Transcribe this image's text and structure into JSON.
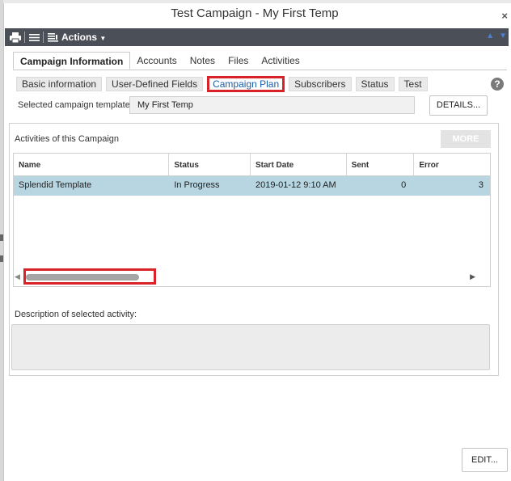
{
  "window": {
    "title": "Test Campaign - My First Temp",
    "close_symbol": "×"
  },
  "toolbar": {
    "print_icon": "print-icon",
    "list_icon": "list-icon",
    "actions_label": "Actions",
    "up_icon": "arrow-up-icon",
    "down_icon": "arrow-down-icon"
  },
  "tabs": [
    {
      "label": "Campaign Information",
      "active": true
    },
    {
      "label": "Accounts"
    },
    {
      "label": "Notes"
    },
    {
      "label": "Files"
    },
    {
      "label": "Activities"
    }
  ],
  "subtabs": [
    {
      "label": "Basic information"
    },
    {
      "label": "User-Defined Fields"
    },
    {
      "label": "Campaign Plan",
      "selected": true
    },
    {
      "label": "Subscribers"
    },
    {
      "label": "Status"
    },
    {
      "label": "Test"
    }
  ],
  "help_symbol": "?",
  "template": {
    "label": "Selected campaign template",
    "value": "My First Temp",
    "details_label": "DETAILS..."
  },
  "activities": {
    "title": "Activities of this Campaign",
    "more_label": "MORE",
    "columns": [
      "Name",
      "Status",
      "Start Date",
      "Sent",
      "Error"
    ],
    "rows": [
      {
        "name": "Splendid Template",
        "status": "In Progress",
        "start_date": "2019-01-12 9:10 AM",
        "sent": "0",
        "error": "3"
      }
    ],
    "horizontal_scroll_position": 0
  },
  "description": {
    "label": "Description of selected activity:",
    "value": ""
  },
  "footer": {
    "edit_label": "EDIT..."
  },
  "colors": {
    "toolbar_bg": "#4b4f57",
    "selected_row": "#b7d6e2",
    "highlight_box": "#d9232a",
    "active_link": "#1a5ea6"
  }
}
